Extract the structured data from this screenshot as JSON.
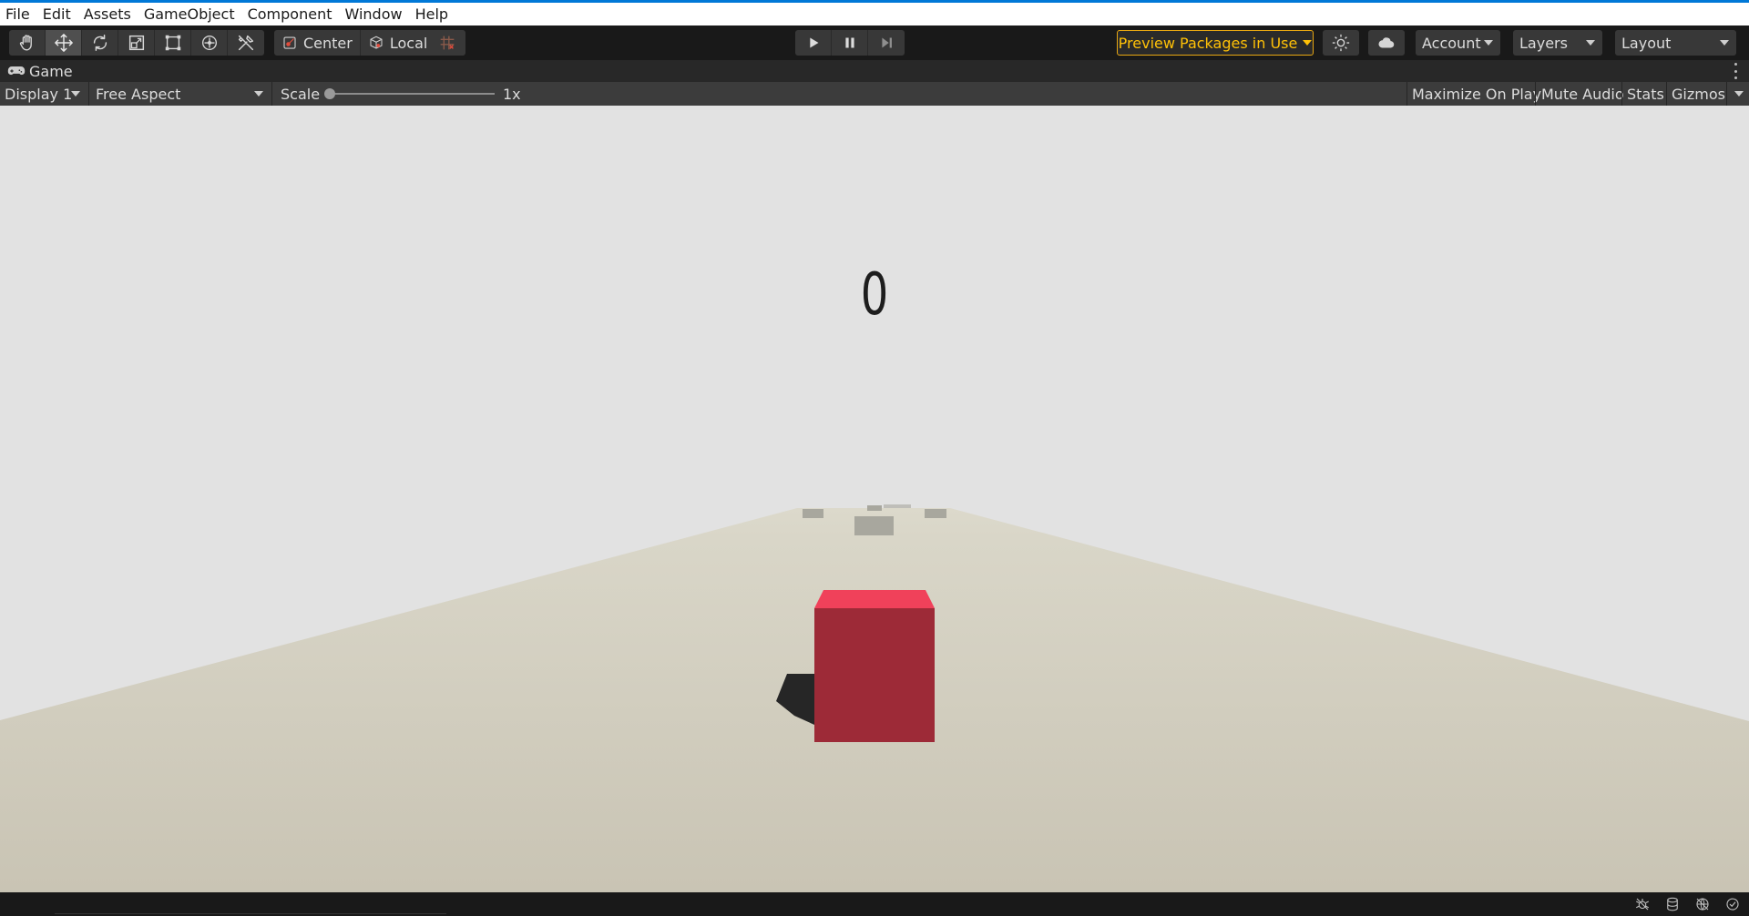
{
  "menubar": {
    "items": [
      "File",
      "Edit",
      "Assets",
      "GameObject",
      "Component",
      "Window",
      "Help"
    ]
  },
  "toolbar": {
    "tools": [
      "hand-tool",
      "move-tool",
      "rotate-tool",
      "scale-tool",
      "rect-tool",
      "transform-tool",
      "custom-tool"
    ],
    "active_tool": "move-tool",
    "pivot_label": "Center",
    "space_label": "Local",
    "preview_packages_label": "Preview Packages in Use",
    "account_label": "Account",
    "layers_label": "Layers",
    "layout_label": "Layout"
  },
  "game_tab": {
    "label": "Game"
  },
  "game_toolbar": {
    "display_label": "Display 1",
    "aspect_label": "Free Aspect",
    "scale_label": "Scale",
    "scale_value": "1x",
    "scale_fraction": 0.0,
    "maximize_label": "Maximize On Play",
    "mute_label": "Mute Audio",
    "stats_label": "Stats",
    "gizmos_label": "Gizmos"
  },
  "game_view": {
    "score": "0",
    "colors": {
      "sky": "#e2e2e2",
      "player_front": "#9d2a37",
      "player_top": "#f0415a",
      "obstacle": "#a8a79e"
    }
  },
  "colors": {
    "preview_packages_accent": "#ffc107",
    "menubar_accent": "#0078d7"
  }
}
